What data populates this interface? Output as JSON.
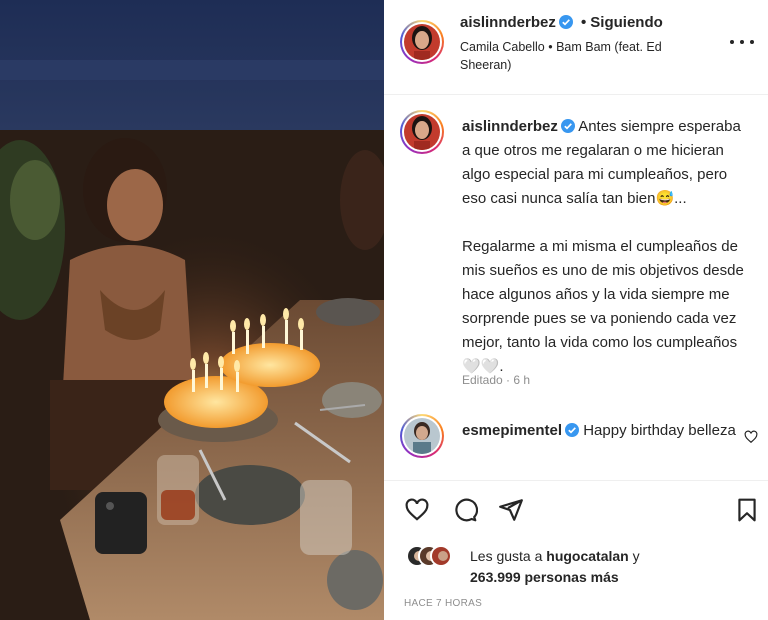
{
  "header": {
    "username": "aislinnderbez",
    "dot": "•",
    "follow_status": "Siguiendo",
    "song": "Camila Cabello • Bam Bam (feat. Ed Sheeran)"
  },
  "caption": {
    "username": "aislinnderbez",
    "paragraph1": "Antes siempre esperaba a que otros me regalaran o me hicieran algo especial para mi cumpleaños, pero eso casi nunca salía tan bien😅...",
    "paragraph2": "Regalarme a mi misma el cumpleaños de mis sueños es uno de mis objetivos desde hace algunos años y la vida siempre me sorprende pues se va poniendo cada vez mejor, tanto la vida como los cumpleaños🤍🤍.",
    "edited": "Editado · 6 h"
  },
  "comment": {
    "username": "esmepimentel",
    "text": "Happy birthday belleza"
  },
  "likes": {
    "prefix": "Les gusta a",
    "user": "hugocatalan",
    "connector": "y",
    "count": "263.999 personas más"
  },
  "timestamp": "HACE 7 HORAS",
  "icons": {
    "like": "heart-icon",
    "comment": "comment-icon",
    "share": "send-icon",
    "save": "bookmark-icon",
    "more": "more-icon",
    "verified": "verified-badge-icon"
  },
  "colors": {
    "verified": "#3897f0",
    "text": "#262626",
    "muted": "#8e8e8e"
  }
}
